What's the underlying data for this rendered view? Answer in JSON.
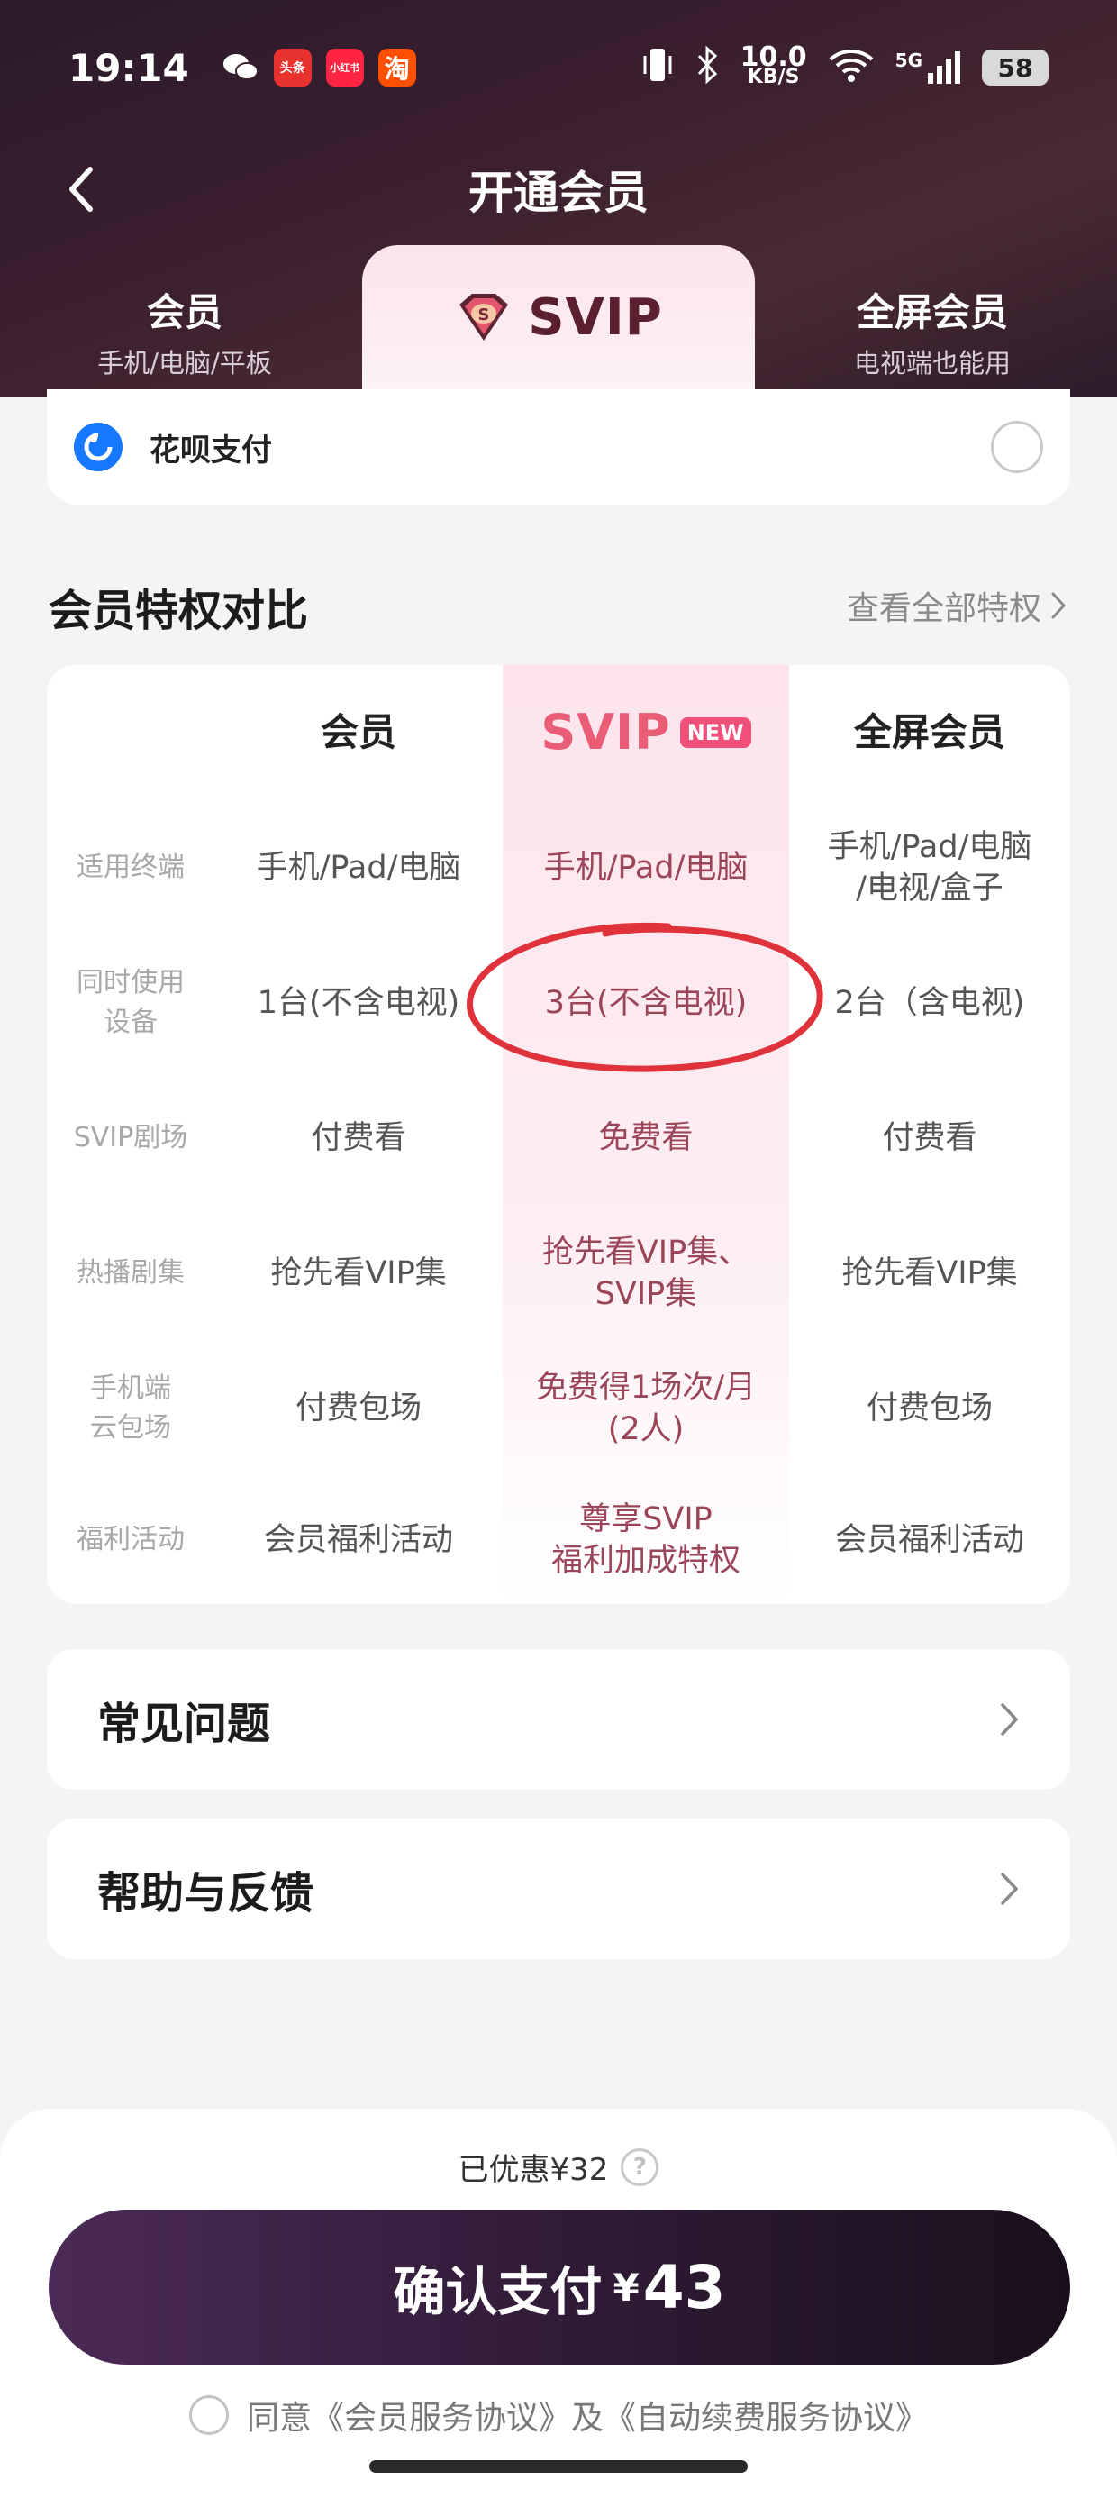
{
  "status_bar": {
    "time": "19:14",
    "apps": [
      {
        "name": "wechat",
        "label": "",
        "color": "#ffffff"
      },
      {
        "name": "toutiao",
        "label": "头条",
        "color": "#e8322e"
      },
      {
        "name": "xiaohongshu",
        "label": "小红书",
        "color": "#ff2442"
      },
      {
        "name": "taobao",
        "label": "淘",
        "color": "#ff4f00"
      }
    ],
    "net_speed_value": "10.0",
    "net_speed_unit": "KB/S",
    "signal_label": "5G",
    "battery": "58"
  },
  "nav": {
    "title": "开通会员"
  },
  "tabs": {
    "left": {
      "main": "会员",
      "sub": "手机/电脑/平板"
    },
    "active": {
      "main": "SVIP"
    },
    "right": {
      "main": "全屏会员",
      "sub": "电视端也能用"
    }
  },
  "payment": {
    "method": "花呗支付",
    "selected": false
  },
  "section": {
    "title": "会员特权对比",
    "link": "查看全部特权"
  },
  "compare": {
    "headers": {
      "col1": "会员",
      "col2": "SVIP",
      "col2_badge": "NEW",
      "col3": "全屏会员"
    },
    "rows": [
      {
        "label": "适用终端",
        "c1": "手机/Pad/电脑",
        "c2": "手机/Pad/电脑",
        "c3": "手机/Pad/电脑\n/电视/盒子"
      },
      {
        "label": "同时使用\n设备",
        "c1": "1台(不含电视)",
        "c2": "3台(不含电视)",
        "c3": "2台（含电视)"
      },
      {
        "label": "SVIP剧场",
        "c1": "付费看",
        "c2": "免费看",
        "c3": "付费看"
      },
      {
        "label": "热播剧集",
        "c1": "抢先看VIP集",
        "c2": "抢先看VIP集、\nSVIP集",
        "c3": "抢先看VIP集"
      },
      {
        "label": "手机端\n云包场",
        "c1": "付费包场",
        "c2": "免费得1场次/月\n(2人)",
        "c3": "付费包场"
      },
      {
        "label": "福利活动",
        "c1": "会员福利活动",
        "c2": "尊享SVIP\n福利加成特权",
        "c3": "会员福利活动"
      }
    ]
  },
  "faq": {
    "label": "常见问题"
  },
  "help": {
    "label": "帮助与反馈"
  },
  "pay_sheet": {
    "saved": "已优惠¥32",
    "help_glyph": "?",
    "confirm_label": "确认支付",
    "currency": "¥",
    "price": "43",
    "agreement": "同意《会员服务协议》及《自动续费服务协议》"
  },
  "colors": {
    "accent_pink": "#e95d77",
    "svip_text": "#9b4558",
    "circle_mark": "#e0323a",
    "button_dark": "#2e1a34"
  }
}
